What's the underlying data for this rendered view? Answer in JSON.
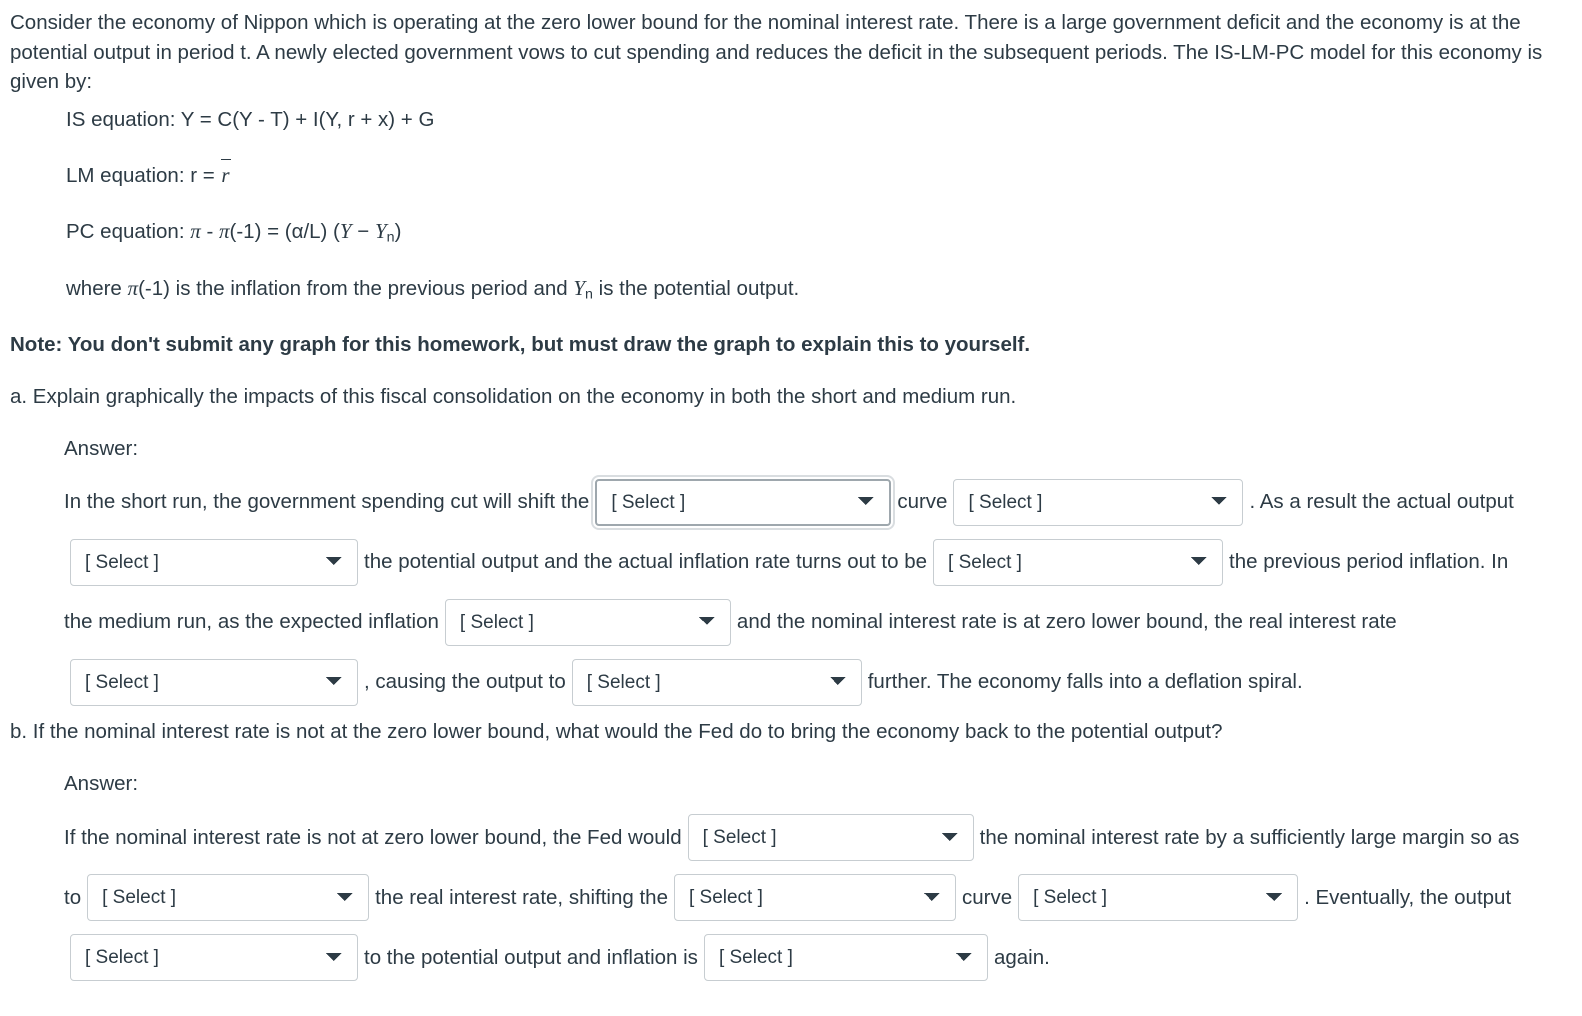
{
  "prompt": {
    "paragraph": "Consider the economy of Nippon which is operating at the zero lower bound for the nominal interest rate. There is a large government deficit and the economy is at the potential output in period t. A newly elected government vows to cut spending and reduces the deficit in the subsequent periods. The IS-LM-PC model for this economy is given by:",
    "equations": {
      "is_label": "IS equation: Y = C(Y - T) + I(Y, r + x) + G",
      "lm_label": "LM equation: r = ",
      "lm_var": "r",
      "pc_prefix": "PC equation: ",
      "pc_pi": "π",
      "pc_mid": " - ",
      "pc_pi2": "π",
      "pc_lag": "(-1) = (α/L) (",
      "pc_Y": "Y",
      "pc_minus": " − ",
      "pc_Yn": "Y",
      "pc_n": "n",
      "pc_close": ")",
      "where_1": "where ",
      "where_pi": "π",
      "where_2": "(-1) is the inflation from the previous period and ",
      "where_Y": "Y",
      "where_n": "n",
      "where_3": " is the potential output."
    },
    "note": "Note: You don't submit any graph for this homework, but must draw the graph to explain this to yourself."
  },
  "select_placeholder": "[ Select ]",
  "questions": [
    {
      "id": "a",
      "question": "a. Explain graphically the impacts of this fiscal consolidation on the economy in both the short and medium run.",
      "answer_label": "Answer:",
      "rows": [
        {
          "segments": [
            {
              "type": "text",
              "value": "In the short run, the government spending cut will shift the"
            },
            {
              "type": "select",
              "name": "shift-curve-select",
              "value": "[ Select ]",
              "focused": true,
              "width": "w296"
            },
            {
              "type": "text",
              "value": "curve"
            },
            {
              "type": "select",
              "name": "shift-direction-select",
              "value": "[ Select ]",
              "focused": false,
              "width": "w290"
            },
            {
              "type": "text",
              "value": ". As a result the actual output"
            }
          ]
        },
        {
          "segments": [
            {
              "type": "select",
              "name": "output-vs-potential-select",
              "value": "[ Select ]",
              "focused": false,
              "width": "w288"
            },
            {
              "type": "text",
              "value": "the potential output and the actual inflation rate turns out to be"
            },
            {
              "type": "select",
              "name": "inflation-vs-previous-select",
              "value": "[ Select ]",
              "focused": false,
              "width": "w290"
            },
            {
              "type": "text",
              "value": "the previous period inflation. In"
            }
          ]
        },
        {
          "segments": [
            {
              "type": "text",
              "value": "the medium run, as the expected inflation"
            },
            {
              "type": "select",
              "name": "expected-inflation-select",
              "value": "[ Select ]",
              "focused": false,
              "width": "w286"
            },
            {
              "type": "text",
              "value": "and the nominal interest rate is at zero lower bound, the real interest rate"
            }
          ]
        },
        {
          "segments": [
            {
              "type": "select",
              "name": "real-rate-change-select",
              "value": "[ Select ]",
              "focused": false,
              "width": "w288"
            },
            {
              "type": "text",
              "value": ", causing the output to"
            },
            {
              "type": "select",
              "name": "output-change-select",
              "value": "[ Select ]",
              "focused": false,
              "width": "w290"
            },
            {
              "type": "text",
              "value": "further. The economy falls into a deflation spiral."
            }
          ]
        }
      ]
    },
    {
      "id": "b",
      "question": "b. If the nominal interest rate is not at the zero lower bound, what would the Fed do to bring the economy back to the potential output?",
      "answer_label": "Answer:",
      "rows": [
        {
          "segments": [
            {
              "type": "text",
              "value": "If the nominal interest rate is not at zero lower bound, the Fed would"
            },
            {
              "type": "select",
              "name": "fed-action-select",
              "value": "[ Select ]",
              "focused": false,
              "width": "w286"
            },
            {
              "type": "text",
              "value": "the nominal interest rate by a sufficiently large margin so as"
            }
          ]
        },
        {
          "segments": [
            {
              "type": "text",
              "value": "to"
            },
            {
              "type": "select",
              "name": "real-rate-action-select",
              "value": "[ Select ]",
              "focused": false,
              "width": "w282"
            },
            {
              "type": "text",
              "value": "the real interest rate, shifting the"
            },
            {
              "type": "select",
              "name": "fed-curve-select",
              "value": "[ Select ]",
              "focused": false,
              "width": "w282"
            },
            {
              "type": "text",
              "value": "curve"
            },
            {
              "type": "select",
              "name": "fed-curve-direction-select",
              "value": "[ Select ]",
              "focused": false,
              "width": "w280"
            },
            {
              "type": "text",
              "value": ". Eventually, the output"
            }
          ]
        },
        {
          "segments": [
            {
              "type": "select",
              "name": "output-return-select",
              "value": "[ Select ]",
              "focused": false,
              "width": "w288"
            },
            {
              "type": "text",
              "value": "to the potential output and inflation is"
            },
            {
              "type": "select",
              "name": "inflation-result-select",
              "value": "[ Select ]",
              "focused": false,
              "width": "w284"
            },
            {
              "type": "text",
              "value": "again."
            }
          ]
        }
      ]
    }
  ]
}
